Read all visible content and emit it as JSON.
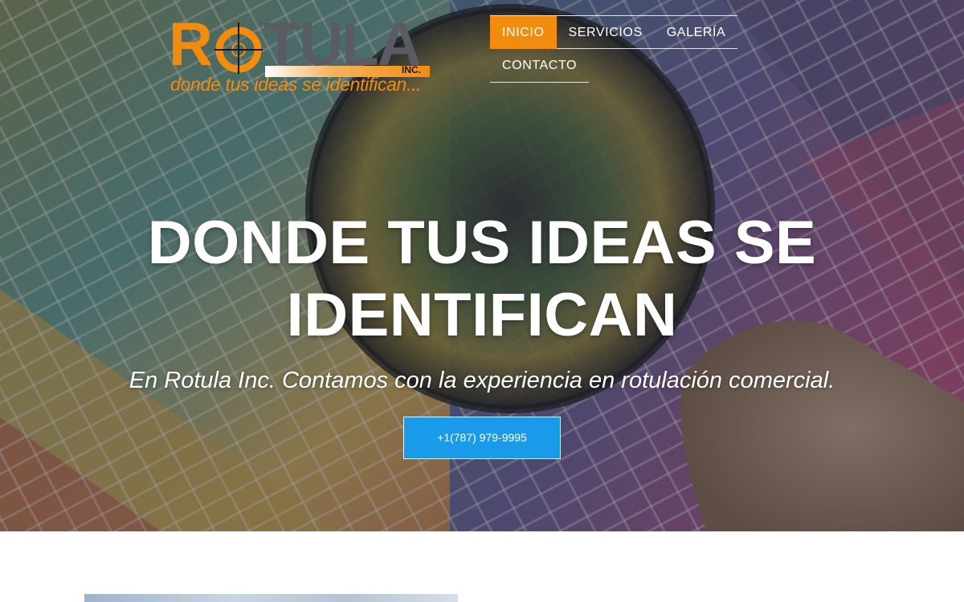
{
  "brand": {
    "logo_letter_r": "R",
    "logo_letters_tula": "TULA",
    "logo_inc": "INC.",
    "tagline": "donde tus ideas se identifican...",
    "accent_color": "#f28c0f",
    "logo_gray": "#5a5c63"
  },
  "nav": {
    "items": [
      {
        "label": "INICIO",
        "active": true
      },
      {
        "label": "SERVICIOS",
        "active": false
      },
      {
        "label": "GALERÍA",
        "active": false
      },
      {
        "label": "CONTACTO",
        "active": false
      }
    ]
  },
  "hero": {
    "title_line1": "DONDE TUS IDEAS SE",
    "title_line2": "IDENTIFICAN",
    "subtitle": "En Rotula Inc. Contamos con la experiencia en rotulación comercial.",
    "cta_label": "+1(787) 979-9995",
    "cta_color": "#1a9bea",
    "background_image": "color-swatch-fan-with-magnifying-glass"
  }
}
